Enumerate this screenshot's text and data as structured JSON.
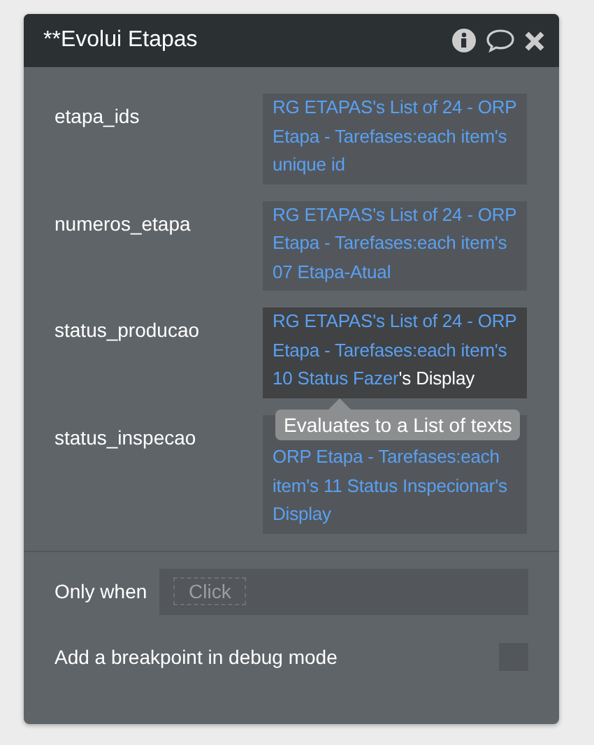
{
  "window": {
    "title": "**Evolui Etapas"
  },
  "params": [
    {
      "name": "etapa_ids",
      "selected": false,
      "segments": [
        {
          "kind": "source",
          "text": "RG ETAPAS's List of 24 - ORP Etapa - Tarefases:each item's unique id"
        }
      ]
    },
    {
      "name": "numeros_etapa",
      "selected": false,
      "segments": [
        {
          "kind": "source",
          "text": "RG ETAPAS's List of 24 - ORP Etapa - Tarefases:each item's 07 Etapa-Atual"
        }
      ]
    },
    {
      "name": "status_producao",
      "selected": true,
      "segments": [
        {
          "kind": "source",
          "text": "RG ETAPAS's List of 24 - ORP Etapa - Tarefases:each item's 10 Status Fazer"
        },
        {
          "kind": "operator",
          "text": "'s Display"
        }
      ],
      "tooltip": "Evaluates to a List of texts"
    },
    {
      "name": "status_inspecao",
      "selected": false,
      "covered": true,
      "segments": [
        {
          "kind": "source",
          "text": "ORP Etapa - Tarefases:each item's 11 Status Inspecionar's Display"
        }
      ]
    }
  ],
  "only_when": {
    "label": "Only when",
    "placeholder": "Click"
  },
  "breakpoint": {
    "label": "Add a breakpoint in debug mode",
    "checked": false
  }
}
